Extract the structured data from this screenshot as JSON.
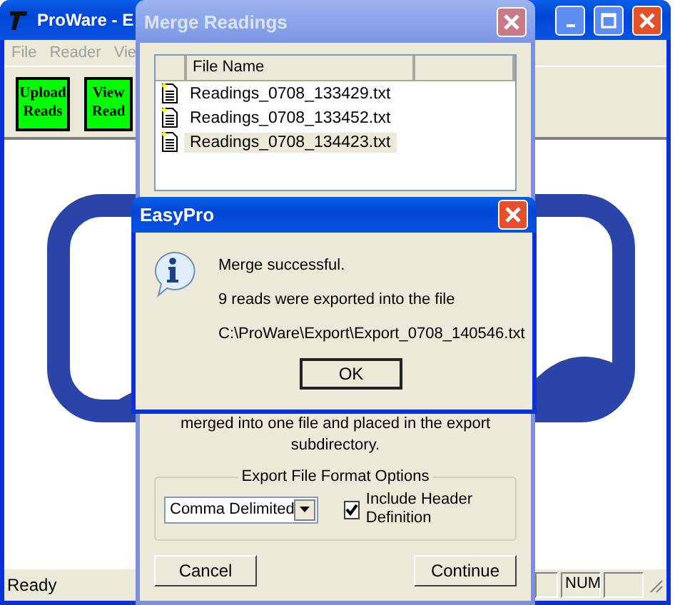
{
  "main_window": {
    "title": "ProWare - E",
    "menu": [
      "File",
      "Reader",
      "Vie"
    ],
    "toolbar": [
      "Upload Reads",
      "View Read"
    ],
    "status_bar": {
      "text": "Ready",
      "panes": [
        "NUM"
      ]
    }
  },
  "merge_window": {
    "title": "Merge Readings",
    "columns": [
      "File Name"
    ],
    "files": [
      {
        "name": "Readings_0708_133429.txt",
        "selected": false
      },
      {
        "name": "Readings_0708_133452.txt",
        "selected": false
      },
      {
        "name": "Readings_0708_134423.txt",
        "selected": true
      }
    ],
    "description": "merged into one file and placed in the export subdirectory.",
    "options": {
      "title": "Export File Format Options",
      "format": "Comma Delimited",
      "include_header": {
        "label": "Include Header Definition",
        "checked": true
      }
    },
    "buttons": [
      "Cancel",
      "Continue"
    ]
  },
  "message_box": {
    "title": "EasyPro",
    "lines": [
      "Merge successful.",
      "9 reads were exported into the file",
      "C:\\ProWare\\Export\\Export_0708_140546.txt"
    ],
    "button": "OK"
  }
}
